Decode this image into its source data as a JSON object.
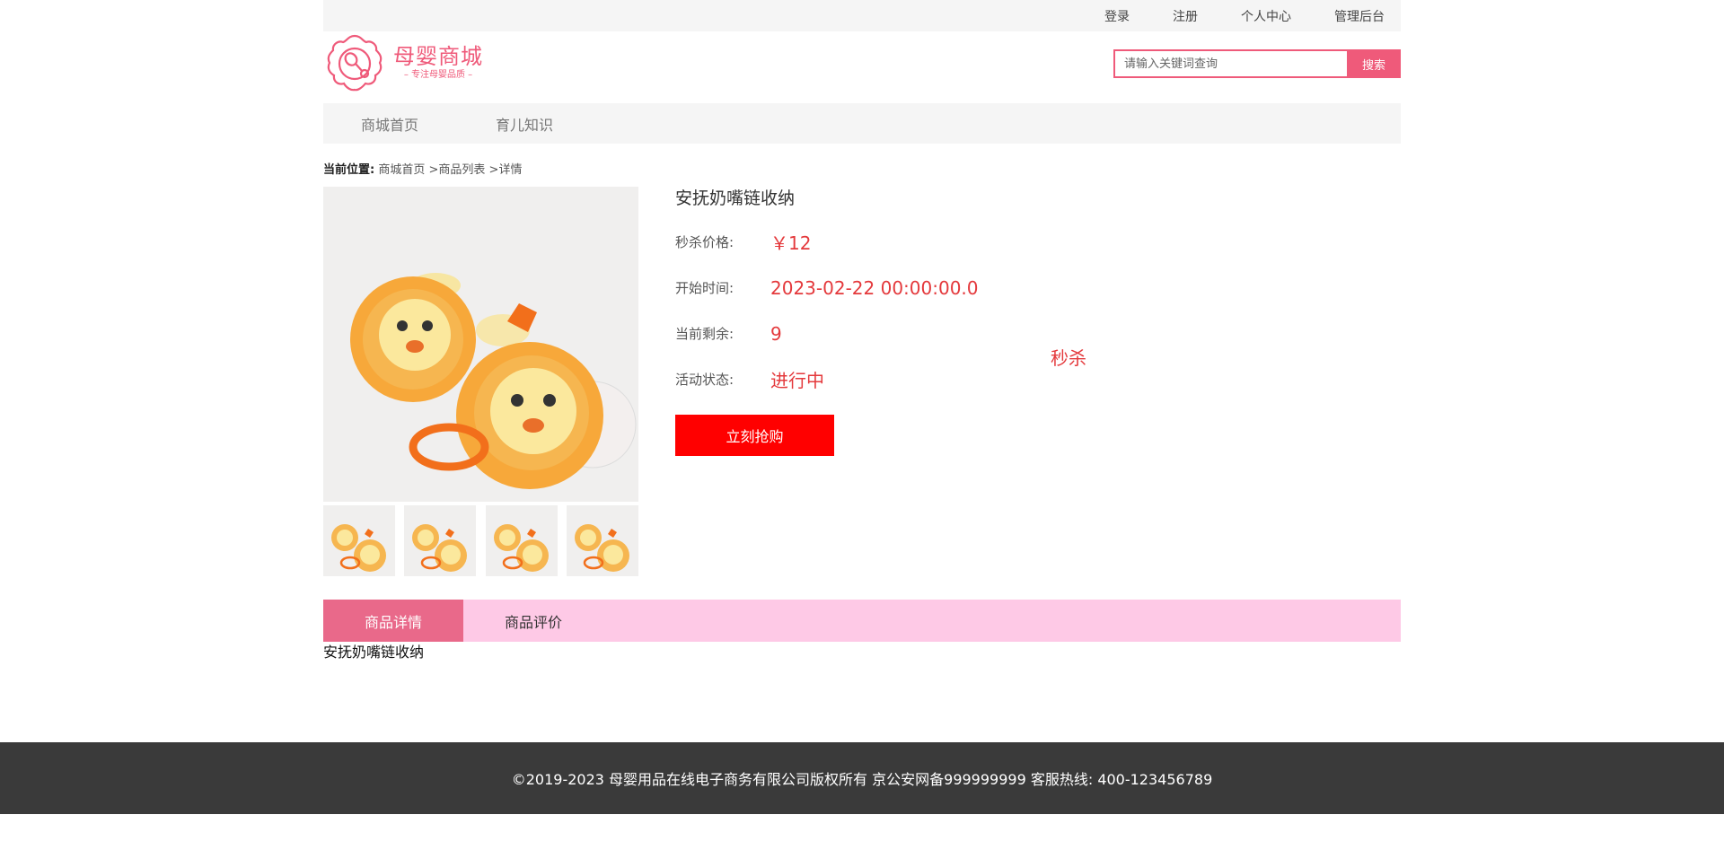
{
  "topbar": {
    "links": [
      "登录",
      "注册",
      "个人中心",
      "管理后台"
    ]
  },
  "header": {
    "logo_title": "母婴商城",
    "logo_subtitle": "– 专注母婴品质 –",
    "search_placeholder": "请输入关键词查询",
    "search_button": "搜索"
  },
  "nav": {
    "items": [
      "商城首页",
      "育儿知识"
    ]
  },
  "breadcrumb": {
    "label": "当前位置:",
    "items": [
      "商城首页",
      ">商品列表",
      ">详情"
    ]
  },
  "product": {
    "title": "安抚奶嘴链收纳",
    "price_label": "秒杀价格:",
    "price_value": "￥12",
    "start_label": "开始时间:",
    "start_value": "2023-02-22 00:00:00.0",
    "stock_label": "当前剩余:",
    "stock_value": "9",
    "status_label": "活动状态:",
    "status_value": "进行中",
    "buy_button": "立刻抢购",
    "seckill_tag": "秒杀",
    "thumbnail_count": 4
  },
  "tabs": {
    "items": [
      "商品详情",
      "商品评价"
    ],
    "active_index": 0
  },
  "detail_text": "安抚奶嘴链收纳",
  "footer": {
    "text": "©2019-2023 母婴用品在线电子商务有限公司版权所有 京公安网备999999999 客服热线: 400-123456789"
  },
  "colors": {
    "brand_pink": "#ef5a7a",
    "price_red": "#e4393c",
    "buy_red": "#ff0000",
    "tab_bar": "#fec9e6",
    "tab_active": "#e9698a",
    "footer_bg": "#3a3a3a"
  }
}
